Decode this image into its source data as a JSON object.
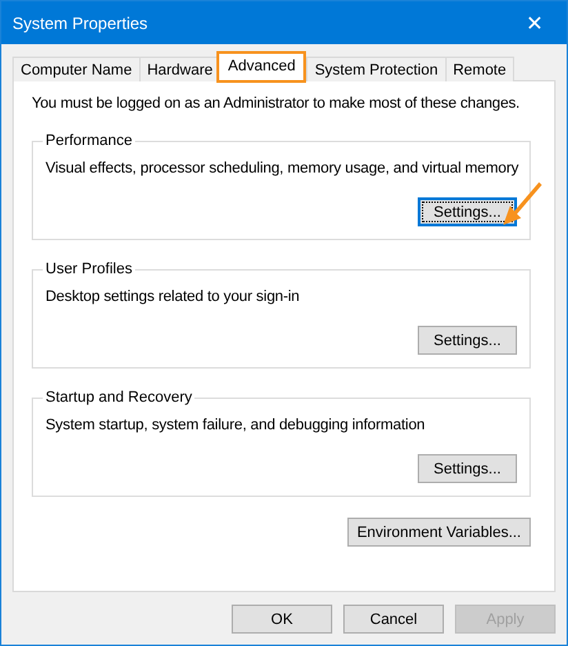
{
  "window": {
    "title": "System Properties",
    "close": "✕"
  },
  "tabs": [
    {
      "label": "Computer Name",
      "selected": false,
      "annotated": false
    },
    {
      "label": "Hardware",
      "selected": false,
      "annotated": false
    },
    {
      "label": "Advanced",
      "selected": true,
      "annotated": true
    },
    {
      "label": "System Protection",
      "selected": false,
      "annotated": false
    },
    {
      "label": "Remote",
      "selected": false,
      "annotated": false
    }
  ],
  "notice": "You must be logged on as an Administrator to make most of these changes.",
  "groups": [
    {
      "title": "Performance",
      "description": "Visual effects, processor scheduling, memory usage, and virtual memory",
      "button": {
        "label": "Settings...",
        "focused": true,
        "pointed": true
      }
    },
    {
      "title": "User Profiles",
      "description": "Desktop settings related to your sign-in",
      "button": {
        "label": "Settings...",
        "focused": false,
        "pointed": false
      }
    },
    {
      "title": "Startup and Recovery",
      "description": "System startup, system failure, and debugging information",
      "button": {
        "label": "Settings...",
        "focused": false,
        "pointed": false
      }
    }
  ],
  "environment_button": {
    "label": "Environment Variables...",
    "disabled": false
  },
  "buttons": [
    {
      "label": "OK",
      "disabled": false
    },
    {
      "label": "Cancel",
      "disabled": false
    },
    {
      "label": "Apply",
      "disabled": true
    }
  ]
}
